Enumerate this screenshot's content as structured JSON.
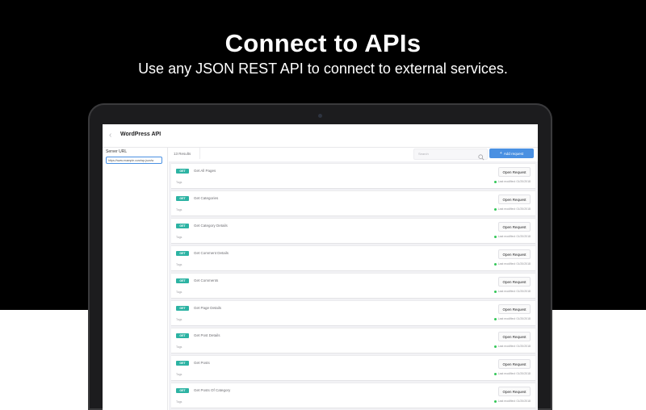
{
  "hero": {
    "title": "Connect to APIs",
    "subtitle": "Use any JSON REST API to connect to external services."
  },
  "app": {
    "title": "WordPress API",
    "server_url_label": "Server URL",
    "server_url_value": "https://www.example.com/wp-json/w",
    "results_count": "13 Results",
    "search_placeholder": "Search",
    "add_request_label": "Add request",
    "accent_color": "#4a90e2",
    "method_color": "#2cb3a3"
  },
  "requests": [
    {
      "method": "GET",
      "name": "Get All Pages",
      "tags": "Tags",
      "open_label": "Open Request",
      "modified": "Last modified: 01/20/2018"
    },
    {
      "method": "GET",
      "name": "Get Categories",
      "tags": "Tags",
      "open_label": "Open Request",
      "modified": "Last modified: 01/20/2018"
    },
    {
      "method": "GET",
      "name": "Get Category Details",
      "tags": "Tags",
      "open_label": "Open Request",
      "modified": "Last modified: 01/20/2018"
    },
    {
      "method": "GET",
      "name": "Get Comment Details",
      "tags": "Tags",
      "open_label": "Open Request",
      "modified": "Last modified: 01/20/2018"
    },
    {
      "method": "GET",
      "name": "Get Comments",
      "tags": "Tags",
      "open_label": "Open Request",
      "modified": "Last modified: 01/20/2018"
    },
    {
      "method": "GET",
      "name": "Get Page Details",
      "tags": "Tags",
      "open_label": "Open Request",
      "modified": "Last modified: 01/20/2018"
    },
    {
      "method": "GET",
      "name": "Get Post Details",
      "tags": "Tags",
      "open_label": "Open Request",
      "modified": "Last modified: 01/20/2018"
    },
    {
      "method": "GET",
      "name": "Get Posts",
      "tags": "Tags",
      "open_label": "Open Request",
      "modified": "Last modified: 01/20/2018"
    },
    {
      "method": "GET",
      "name": "Get Posts Of Category",
      "tags": "Tags",
      "open_label": "Open Request",
      "modified": "Last modified: 01/20/2018"
    }
  ]
}
